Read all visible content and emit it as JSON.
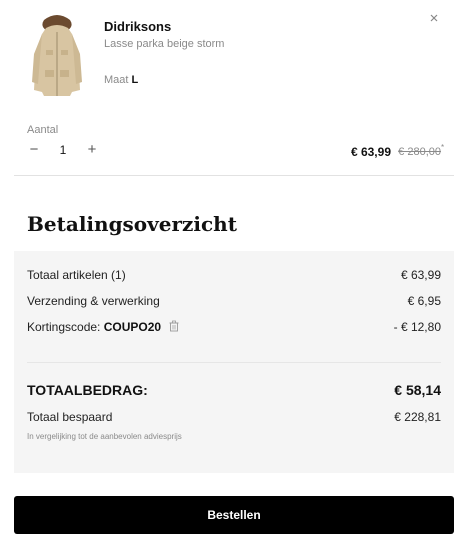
{
  "product": {
    "brand": "Didriksons",
    "name": "Lasse parka beige storm",
    "size_label": "Maat",
    "size_value": "L",
    "image": "parka-beige"
  },
  "quantity": {
    "label": "Aantal",
    "value": "1",
    "minus": "−",
    "plus": "+"
  },
  "pricing": {
    "price": "€ 63,99",
    "old_price": "€ 280,00",
    "asterisk": "*"
  },
  "summary": {
    "title": "Betalingsoverzicht",
    "rows": [
      {
        "label": "Totaal artikelen (1)",
        "value": "€ 63,99"
      },
      {
        "label": "Verzending & verwerking",
        "value": "€ 6,95"
      },
      {
        "label": "Kortingscode:",
        "code": "COUPO20",
        "value": "- € 12,80"
      }
    ],
    "total_label": "TOTAALBEDRAG:",
    "total_value": "€ 58,14",
    "saved_label": "Totaal bespaard",
    "saved_value": "€ 228,81",
    "note": "In vergelijking tot de aanbevolen adviesprijs"
  },
  "actions": {
    "order": "Bestellen"
  },
  "colors": {
    "panel_bg": "#f5f5f5",
    "button_bg": "#000000",
    "muted_text": "#8a8a8a"
  },
  "icons": {
    "close": "close-icon",
    "trash": "trash-icon"
  }
}
